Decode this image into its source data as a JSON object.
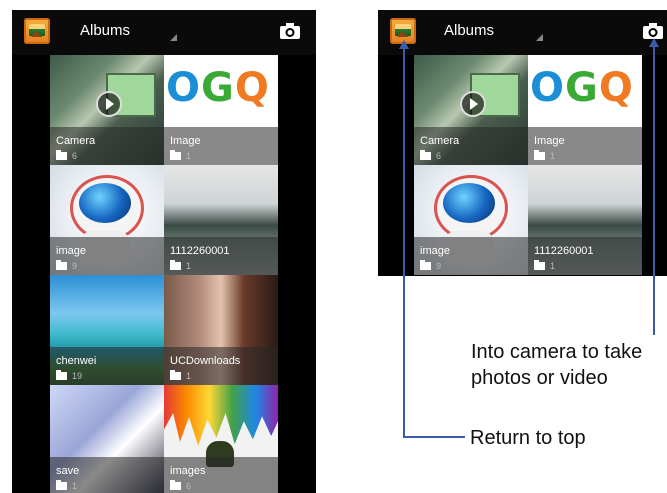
{
  "actionbar": {
    "title": "Albums"
  },
  "albums": [
    {
      "name": "Camera",
      "count": "6"
    },
    {
      "name": "Image",
      "count": "1"
    },
    {
      "name": "image",
      "count": "9"
    },
    {
      "name": "1112260001",
      "count": "1"
    },
    {
      "name": "chenwei",
      "count": "19"
    },
    {
      "name": "UCDownloads",
      "count": "1"
    },
    {
      "name": "save",
      "count": "1"
    },
    {
      "name": "images",
      "count": "6"
    }
  ],
  "ogq_logo": {
    "letters": [
      "O",
      "G",
      "Q"
    ],
    "colors": [
      "#1a8fd6",
      "#3aaa35",
      "#f07a22"
    ]
  },
  "annotations": {
    "camera_line1": "Into camera to take",
    "camera_line2": "photos or video",
    "return_top": "Return to top"
  },
  "colors": {
    "callout": "#3b5ba9",
    "phone_bg": "#000000"
  }
}
